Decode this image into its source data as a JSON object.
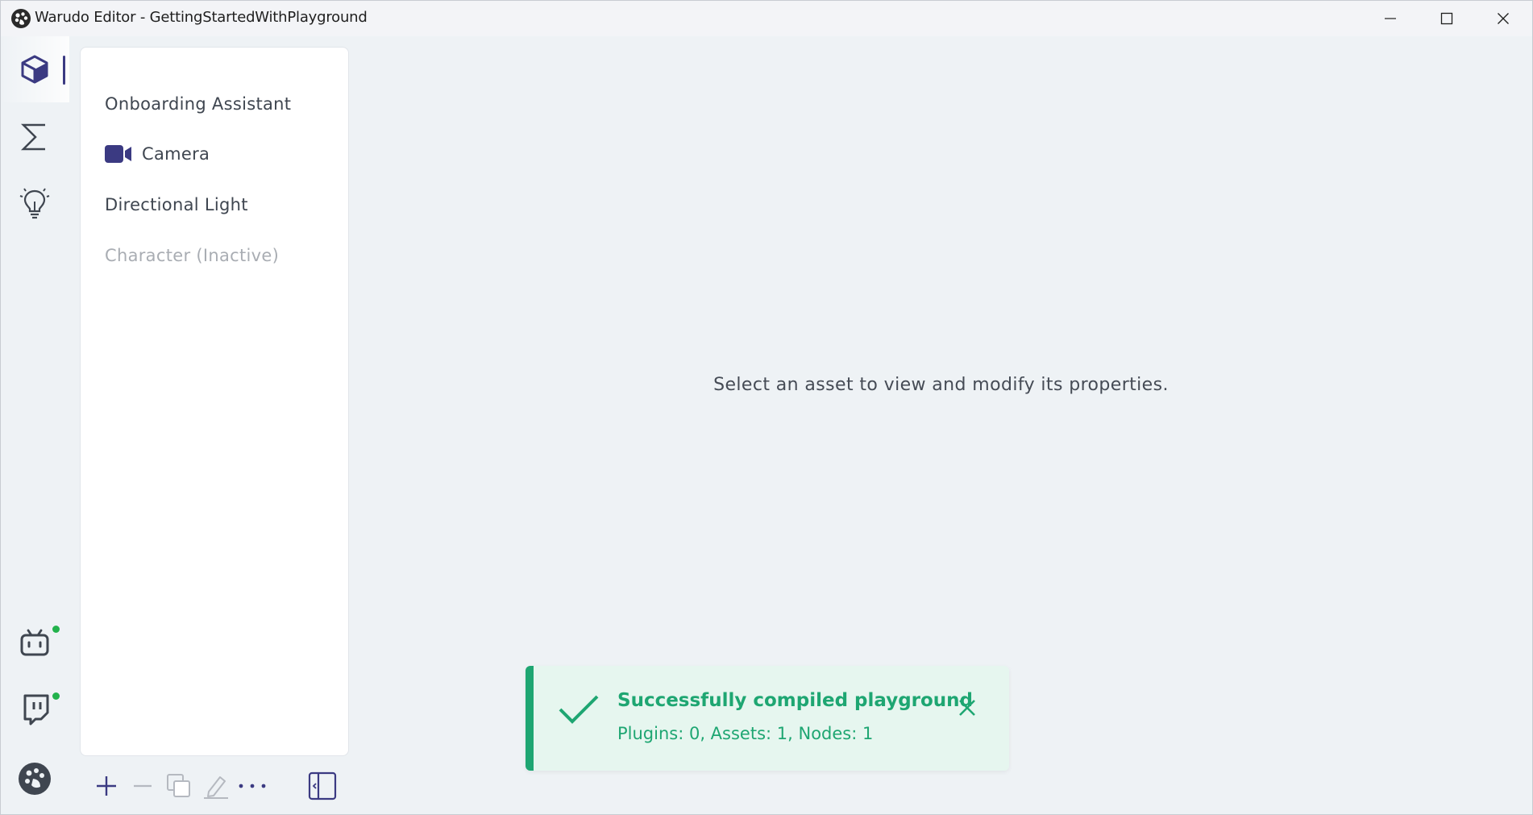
{
  "window": {
    "title": "Warudo Editor - GettingStartedWithPlayground",
    "controls": {
      "minimize": "minimize-icon",
      "maximize": "maximize-icon",
      "close": "close-icon"
    }
  },
  "iconbar": {
    "top_items": [
      {
        "icon": "cube-icon",
        "active": true
      },
      {
        "icon": "sigma-icon",
        "active": false
      },
      {
        "icon": "lightbulb-icon",
        "active": false
      }
    ],
    "bottom_items": [
      {
        "icon": "bilibili-icon",
        "status": "online"
      },
      {
        "icon": "twitch-icon",
        "status": "online"
      },
      {
        "icon": "palette-icon"
      }
    ],
    "status_color": "#22b24c",
    "accent_color": "#3b3a82"
  },
  "assets": {
    "items": [
      {
        "label": "Onboarding Assistant",
        "icon": null,
        "inactive": false
      },
      {
        "label": "Camera",
        "icon": "camera-icon",
        "inactive": false
      },
      {
        "label": "Directional Light",
        "icon": null,
        "inactive": false
      },
      {
        "label": "Character (Inactive)",
        "icon": null,
        "inactive": true
      }
    ],
    "toolbar": [
      "add-icon",
      "remove-icon",
      "duplicate-icon",
      "rename-icon",
      "more-icon",
      "collapse-panel-icon"
    ]
  },
  "main": {
    "message": "Select an asset to view and modify its properties."
  },
  "toast": {
    "title": "Successfully compiled playground",
    "body": "Plugins: 0, Assets: 1, Nodes: 1",
    "color": "#1ea672",
    "background": "#e6f6ef"
  }
}
